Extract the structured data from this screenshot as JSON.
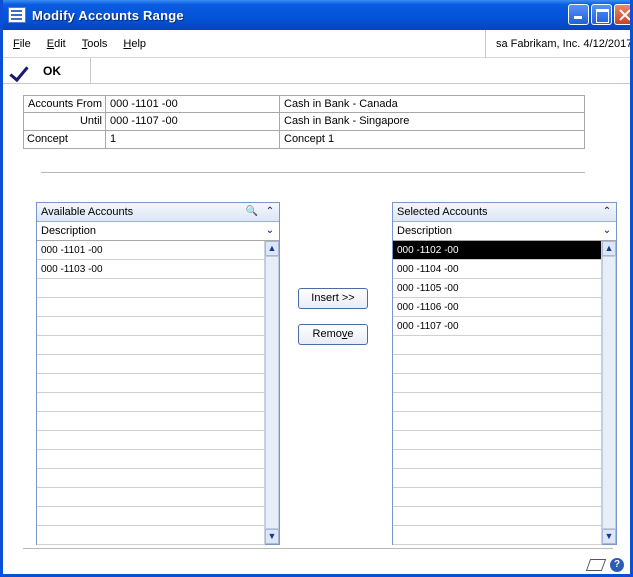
{
  "window": {
    "title": "Modify Accounts Range"
  },
  "menu": [
    {
      "label": "File",
      "u": "F",
      "rest": "ile"
    },
    {
      "label": "Edit",
      "u": "E",
      "rest": "dit"
    },
    {
      "label": "Tools",
      "u": "T",
      "rest": "ools"
    },
    {
      "label": "Help",
      "u": "H",
      "rest": "elp"
    }
  ],
  "company_info": "sa  Fabrikam, Inc.  4/12/2017",
  "toolbar": {
    "ok_label": "OK"
  },
  "fields": {
    "accounts_from_label": "Accounts From",
    "accounts_from_value": "000 -1101 -00",
    "accounts_from_desc": "Cash in Bank - Canada",
    "until_label": "Until",
    "until_value": "000 -1107 -00",
    "until_desc": "Cash in Bank - Singapore",
    "concept_label": "Concept",
    "concept_value": "1",
    "concept_desc": "Concept 1"
  },
  "available": {
    "title": "Available Accounts",
    "column": "Description",
    "rows": [
      "000 -1101 -00",
      "000 -1103 -00"
    ]
  },
  "selected": {
    "title": "Selected Accounts",
    "column": "Description",
    "rows": [
      "000 -1102 -00",
      "000 -1104 -00",
      "000 -1105 -00",
      "000 -1106 -00",
      "000 -1107 -00"
    ],
    "selected_index": 0
  },
  "buttons": {
    "insert": "Insert >>",
    "remove_u": "Remo",
    "remove_uchar": "v",
    "remove_rest": "e"
  }
}
